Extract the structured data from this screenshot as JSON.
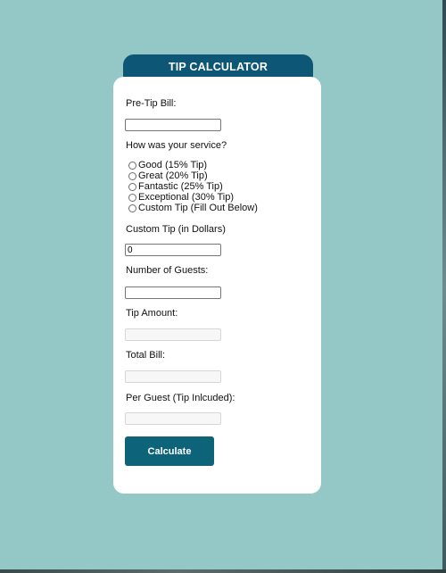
{
  "header": {
    "title": "TIP CALCULATOR"
  },
  "form": {
    "bill_label": "Pre-Tip Bill:",
    "bill_value": "",
    "service_label": "How was your service?",
    "service_options": [
      "Good (15% Tip)",
      "Great (20% Tip)",
      "Fantastic (25% Tip)",
      "Exceptional (30% Tip)",
      "Custom Tip (Fill Out Below)"
    ],
    "custom_tip_label": "Custom Tip (in Dollars)",
    "custom_tip_value": "0",
    "guests_label": "Number of Guests:",
    "guests_value": "",
    "tip_amount_label": "Tip Amount:",
    "tip_amount_value": "",
    "total_bill_label": "Total Bill:",
    "total_bill_value": "",
    "per_guest_label": "Per Guest (Tip Inlcuded):",
    "per_guest_value": "",
    "calculate_label": "Calculate"
  },
  "colors": {
    "background": "#93c8c6",
    "header": "#0d5675",
    "button": "#0d6377",
    "card": "#ffffff"
  }
}
